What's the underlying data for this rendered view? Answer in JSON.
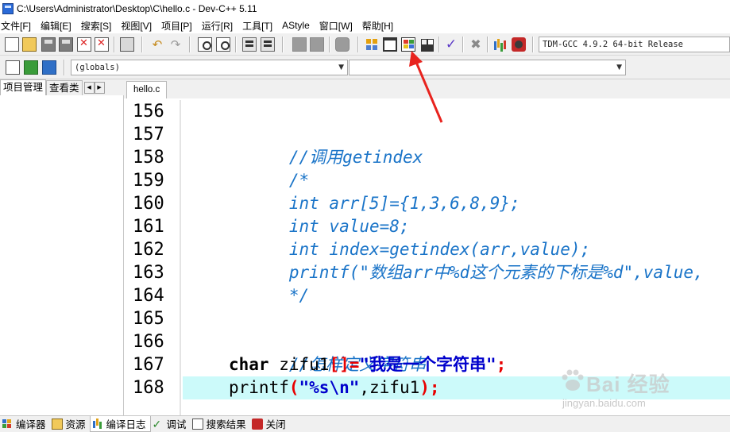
{
  "window": {
    "title": "C:\\Users\\Administrator\\Desktop\\C\\hello.c - Dev-C++ 5.11"
  },
  "menu": [
    "文件[F]",
    "编辑[E]",
    "搜索[S]",
    "视图[V]",
    "项目[P]",
    "运行[R]",
    "工具[T]",
    "AStyle",
    "窗口[W]",
    "帮助[H]"
  ],
  "toolbar": {
    "compiler_select": "TDM-GCC 4.9.2 64-bit Release",
    "scope_select": "(globals)",
    "function_select": ""
  },
  "left_panel": {
    "tabs": [
      "项目管理",
      "查看类"
    ],
    "scroll_left": "◀",
    "scroll_right": "▶"
  },
  "editor": {
    "file_tab": "hello.c",
    "line_numbers": [
      "156",
      "157",
      "158",
      "159",
      "160",
      "161",
      "162",
      "163",
      "164",
      "165",
      "166",
      "167",
      "168"
    ],
    "highlighted_line": "168",
    "code": {
      "l157": "//调用getindex",
      "l158": "/*",
      "l159": "int arr[5]={1,3,6,8,9};",
      "l160": "int value=8;",
      "l161": "int index=getindex(arr,value);",
      "l162": "printf(\"数组arr中%d这个元素的下标是%d\",value,",
      "l163": "*/",
      "l166": "//怎样定义字符串",
      "l167_kw": "char",
      "l167_name": " zifu1",
      "l167_sym": "[]=",
      "l167_str": "\"我是一个字符串\"",
      "l167_end": ";",
      "l168_fn": "printf",
      "l168_open": "(",
      "l168_str": "\"%s\\n\"",
      "l168_rest": ",zifu1",
      "l168_close": ");"
    }
  },
  "bottom_tabs": [
    "编译器",
    "资源",
    "编译日志",
    "调试",
    "搜索结果",
    "关闭"
  ],
  "watermark": {
    "text": "Bai  经验",
    "sub": "jingyan.baidu.com"
  },
  "colors": {
    "annotation_arrow": "#e8231e",
    "comment": "#1a74c8",
    "highlight_line": "#ccfafa",
    "string": "#0000cc",
    "symbol": "#e80000"
  }
}
